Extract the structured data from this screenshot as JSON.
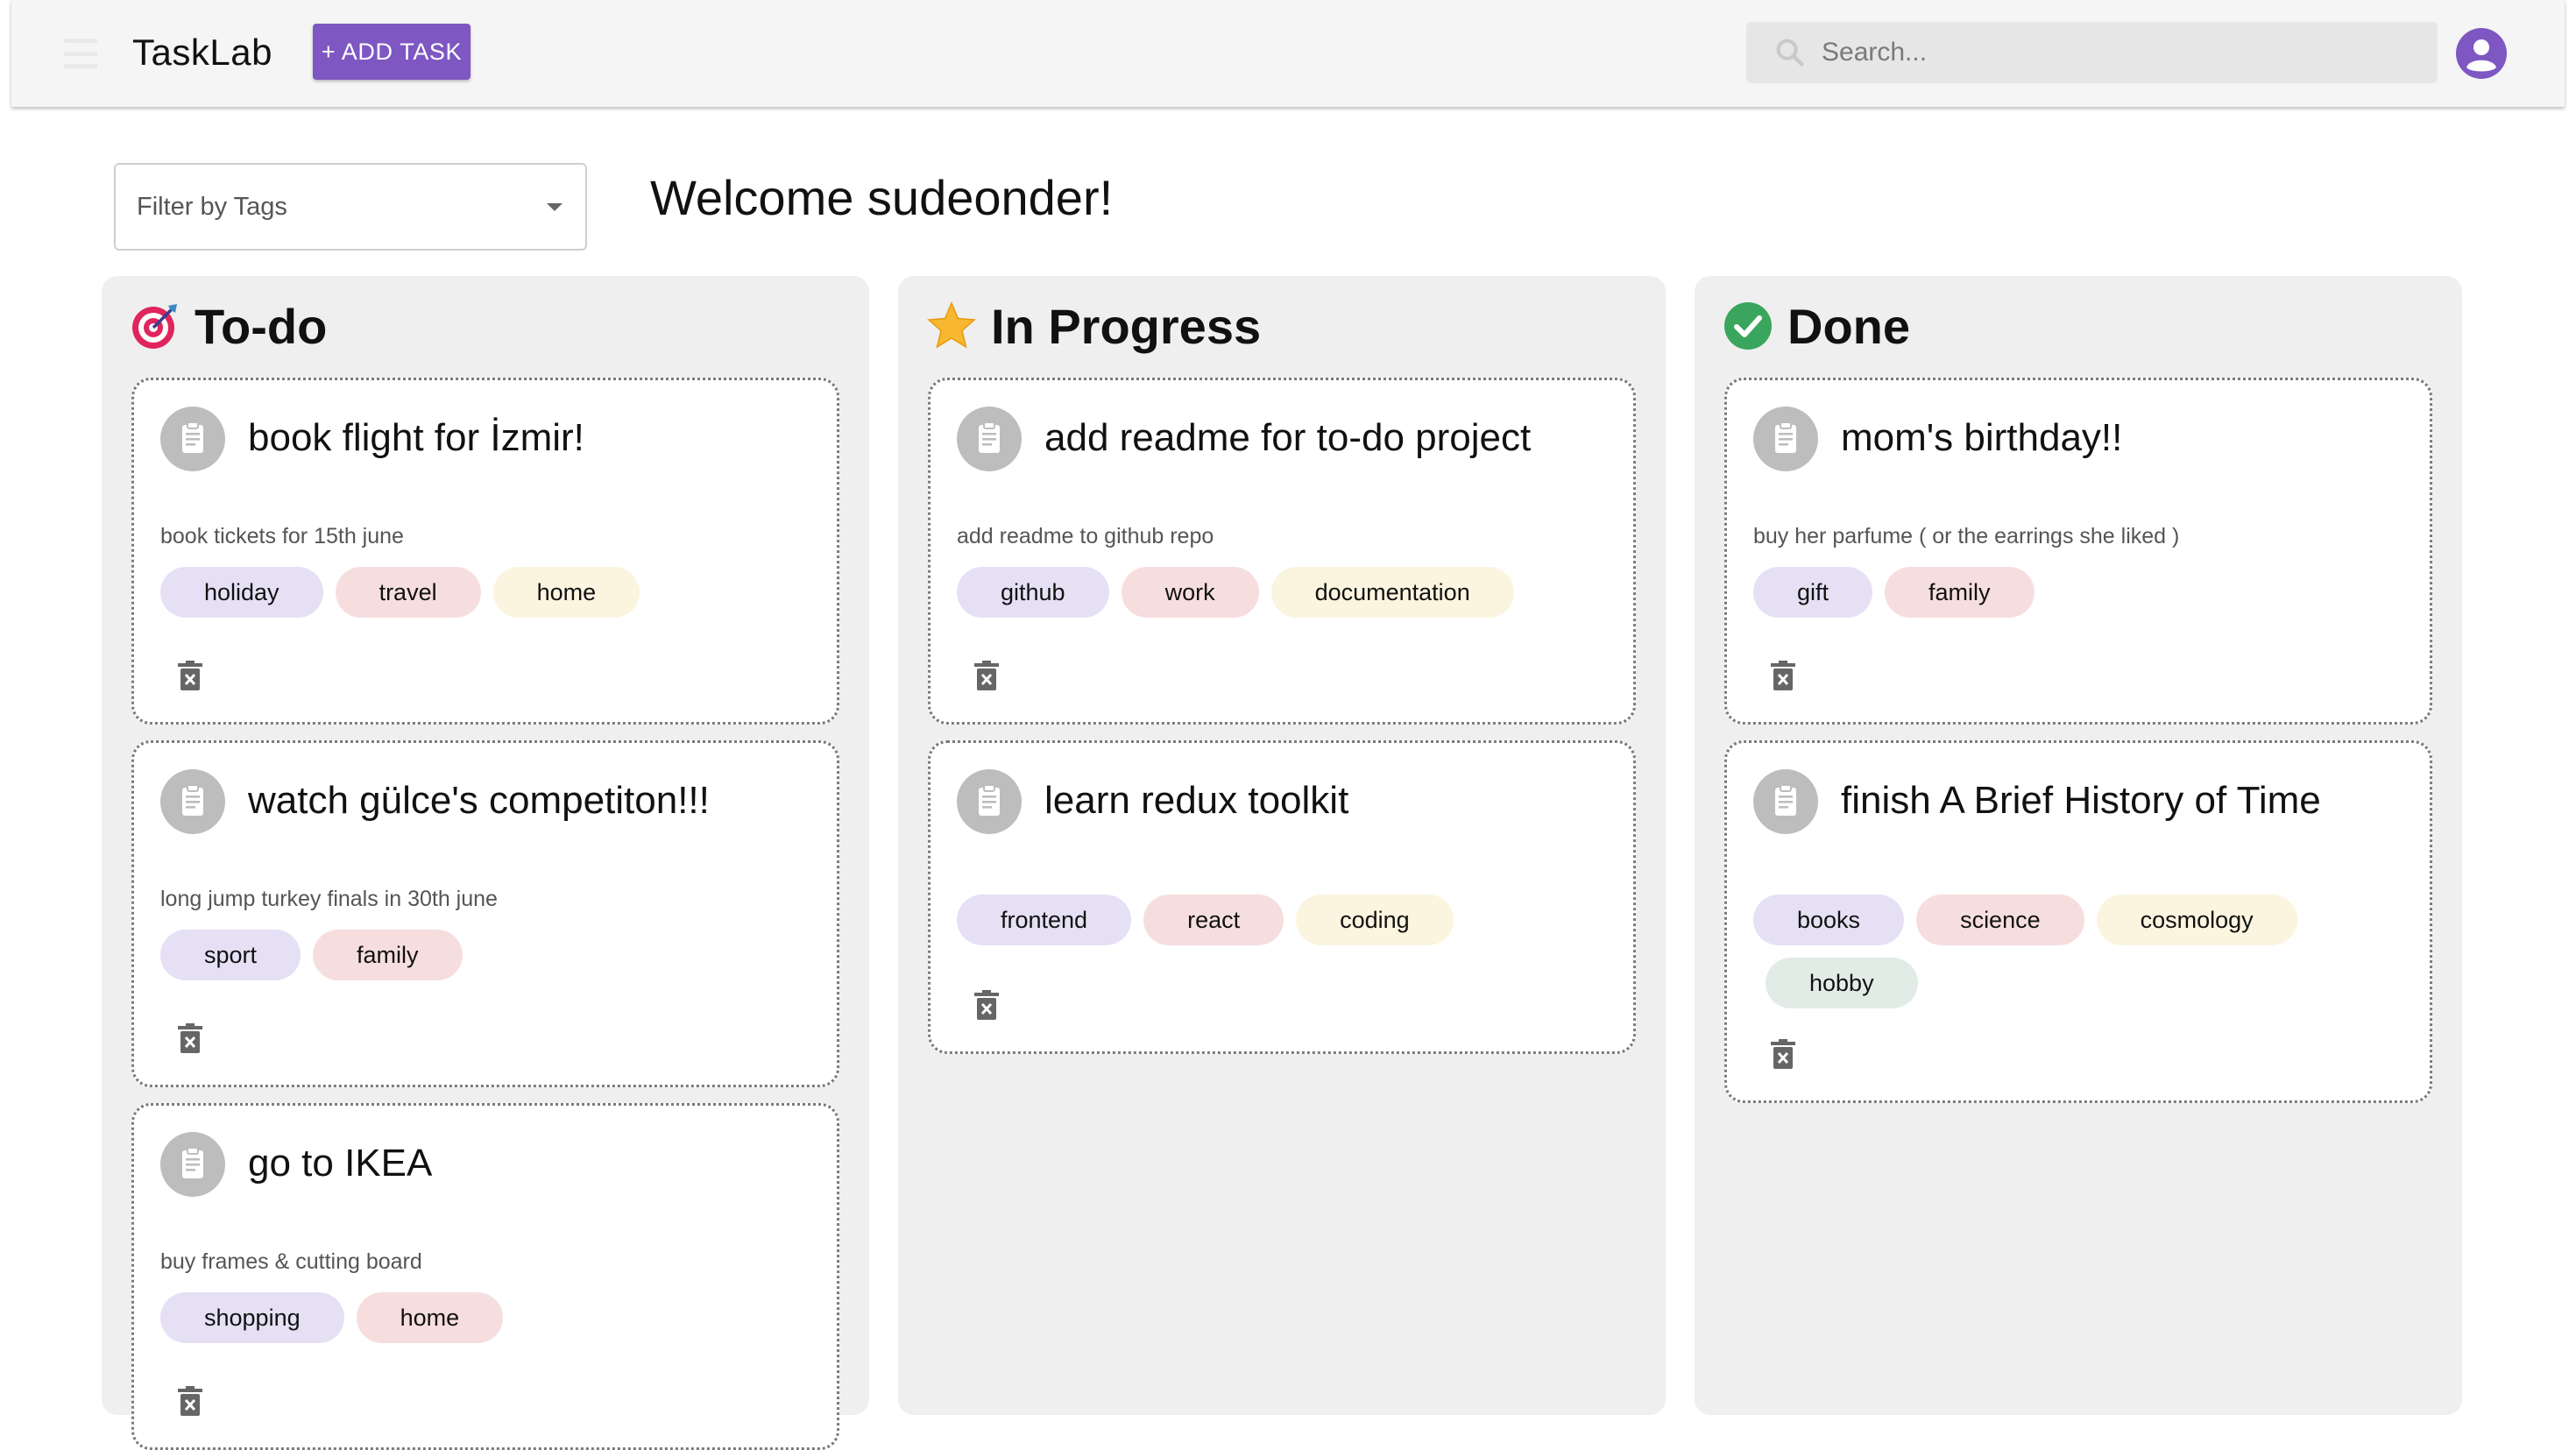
{
  "app": {
    "brand": "TaskLab",
    "add_task_label": "+ ADD TASK",
    "search_placeholder": "Search...",
    "menu_icon": "hamburger-menu-icon",
    "avatar_icon": "user-avatar-icon"
  },
  "filter": {
    "label": "Filter by Tags",
    "icon": "dropdown-arrow-icon"
  },
  "welcome": "Welcome sudeonder!",
  "colors": {
    "primary": "#7e57c2",
    "column_bg": "#efefef",
    "tag_palette": [
      "#e6e0f5",
      "#f7dede",
      "#fbf4df",
      "#e2ece7"
    ]
  },
  "columns": [
    {
      "title": "To-do",
      "icon": "target-dart-icon",
      "cards": [
        {
          "title": "book flight for İzmir!",
          "description": "book tickets for 15th june",
          "tags": [
            "holiday",
            "travel",
            "home"
          ]
        },
        {
          "title": "watch gülce's competiton!!!",
          "description": "long jump turkey finals in 30th june",
          "tags": [
            "sport",
            "family"
          ]
        },
        {
          "title": "go to IKEA",
          "description": "buy frames & cutting board",
          "tags": [
            "shopping",
            "home"
          ]
        }
      ]
    },
    {
      "title": "In Progress",
      "icon": "star-icon",
      "cards": [
        {
          "title": "add readme for to-do project",
          "description": "add readme to github repo",
          "tags": [
            "github",
            "work",
            "documentation"
          ]
        },
        {
          "title": "learn redux toolkit",
          "description": "",
          "tags": [
            "frontend",
            "react",
            "coding"
          ]
        }
      ]
    },
    {
      "title": "Done",
      "icon": "check-circle-icon",
      "cards": [
        {
          "title": "mom's birthday!!",
          "description": "buy her parfume ( or the earrings she liked )",
          "tags": [
            "gift",
            "family"
          ]
        },
        {
          "title": "finish A Brief History of Time",
          "description": "",
          "tags": [
            "books",
            "science",
            "cosmology",
            "hobby"
          ]
        }
      ]
    }
  ]
}
